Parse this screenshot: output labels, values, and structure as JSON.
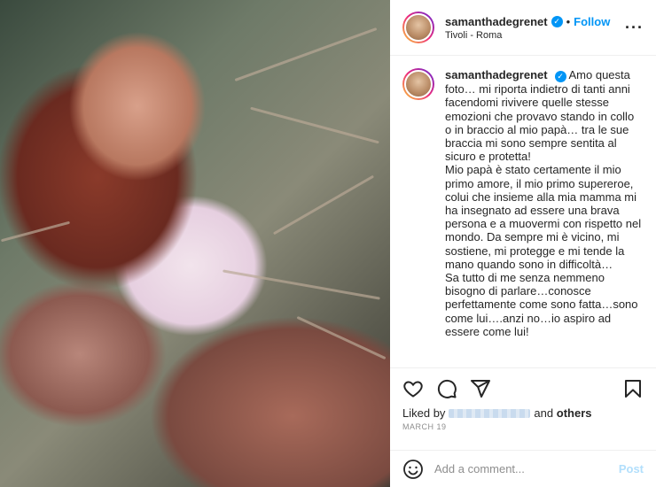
{
  "post": {
    "image_alt": "",
    "author": {
      "username": "samanthadegrenet",
      "location": "Tivoli - Roma",
      "follow_label": "Follow",
      "separator": "•"
    },
    "caption": {
      "username": "samanthadegrenet",
      "paragraphs": [
        "Amo questa foto… mi riporta indietro di tanti anni facendomi rivivere quelle stesse emozioni che provavo stando in collo o in braccio al mio papà… tra le sue braccia mi sono sempre sentita al sicuro e protetta!",
        "Mio papà è stato certamente il mio primo amore, il mio primo supereroe, colui che insieme alla mia mamma mi ha insegnato ad essere una brava persona e a muovermi con rispetto nel mondo. Da sempre mi è vicino, mi sostiene, mi protegge e mi tende la mano quando sono in difficoltà…",
        "Sa tutto di me senza nemmeno bisogno di parlare…conosce perfettamente come sono fatta…sono come lui….anzi no…io aspiro ad essere come lui!"
      ]
    },
    "likes": {
      "prefix": "Liked by",
      "suffix_and": "and",
      "suffix_others": "others"
    },
    "date": "MARCH 19",
    "comment": {
      "placeholder": "Add a comment...",
      "post_label": "Post"
    }
  },
  "icons": {
    "like": "heart-icon",
    "comment": "comment-icon",
    "share": "share-icon",
    "save": "bookmark-icon",
    "emoji": "emoji-icon",
    "more": "more-options-icon"
  },
  "colors": {
    "accent": "#0095f6",
    "post_disabled": "#b2dffc",
    "muted": "#8e8e8e",
    "border": "#efefef"
  }
}
